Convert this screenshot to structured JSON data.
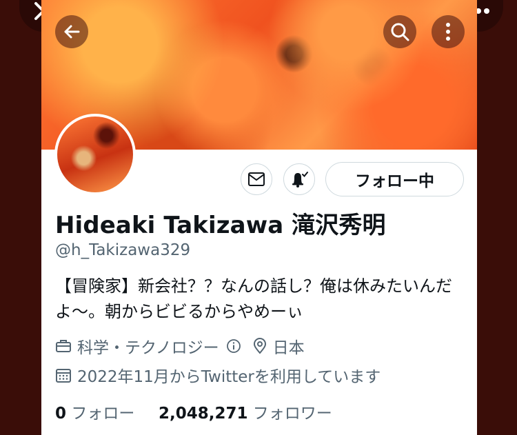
{
  "profile": {
    "display_name": "Hideaki Takizawa 滝沢秀明",
    "handle": "@h_Takizawa329",
    "bio": "【冒険家】新会社？？なんの話し？俺は休みたいんだよ〜。朝からビビるからやめーぃ",
    "category": "科学・テクノロジー",
    "location": "日本",
    "joined": "2022年11月からTwitterを利用しています",
    "following_count": "0",
    "following_label": "フォロー",
    "followers_count": "2,048,271",
    "followers_label": "フォロワー"
  },
  "actions": {
    "follow_label": "フォロー中"
  },
  "icons": {
    "close": "close-icon",
    "more": "more-horizontal-icon",
    "back": "back-arrow-icon",
    "search": "search-icon",
    "more_vertical": "more-vertical-icon",
    "mail": "mail-icon",
    "notify": "bell-check-icon",
    "category": "briefcase-icon",
    "info": "info-icon",
    "location": "location-pin-icon",
    "calendar": "calendar-icon"
  },
  "colors": {
    "text": "#0f1419",
    "secondary": "#536471",
    "border": "#cfd9de",
    "banner": "#f0521f"
  }
}
